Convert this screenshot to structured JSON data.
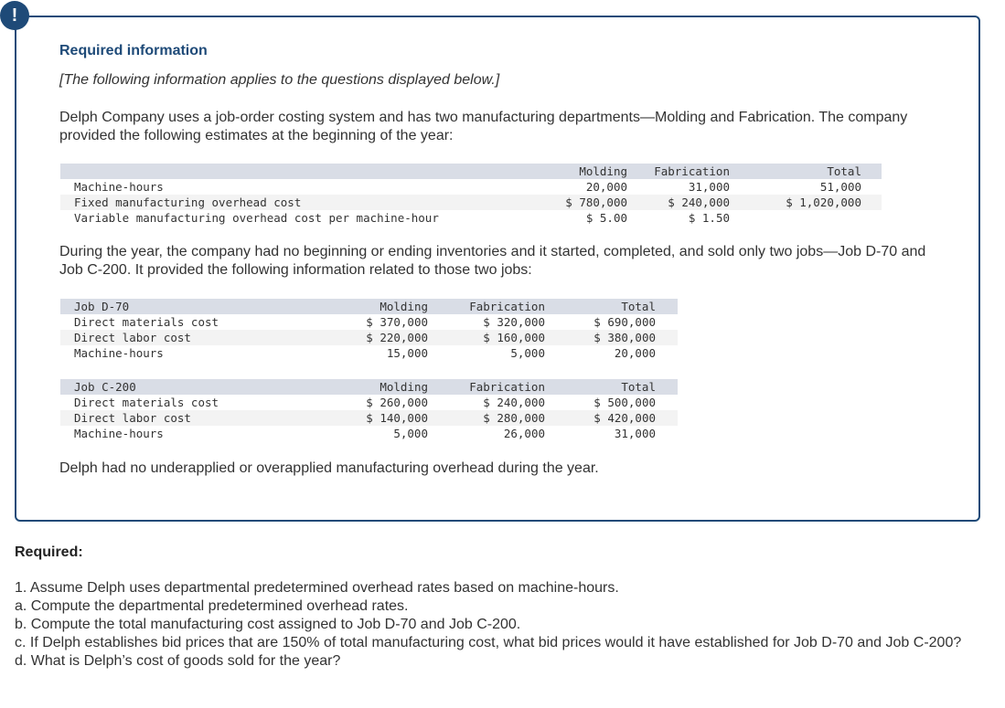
{
  "alert": {
    "icon": "exclamation-icon",
    "symbol": "!"
  },
  "info": {
    "title": "Required information",
    "note": "[The following information applies to the questions displayed below.]",
    "paragraph1": "Delph Company uses a job-order costing system and has two manufacturing departments—Molding and Fabrication. The company provided the following estimates at the beginning of the year:",
    "paragraph2": "During the year, the company had no beginning or ending inventories and it started, completed, and sold only two jobs—Job D-70 and Job C-200. It provided the following information related to those two jobs:",
    "paragraph3": "Delph had no underapplied or overapplied manufacturing overhead during the year."
  },
  "estimates_table": {
    "headers": [
      "",
      "Molding",
      "Fabrication",
      "Total"
    ],
    "rows": [
      [
        "Machine-hours",
        "20,000",
        "31,000",
        "51,000"
      ],
      [
        "Fixed manufacturing overhead cost",
        "$ 780,000",
        "$ 240,000",
        "$ 1,020,000"
      ],
      [
        "Variable manufacturing overhead cost per machine-hour",
        "$ 5.00",
        "$ 1.50",
        ""
      ]
    ]
  },
  "job_d70_table": {
    "headers": [
      "Job D-70",
      "Molding",
      "Fabrication",
      "Total"
    ],
    "rows": [
      [
        "Direct materials cost",
        "$ 370,000",
        "$ 320,000",
        "$ 690,000"
      ],
      [
        "Direct labor cost",
        "$ 220,000",
        "$ 160,000",
        "$ 380,000"
      ],
      [
        "Machine-hours",
        "15,000",
        "5,000",
        "20,000"
      ]
    ]
  },
  "job_c200_table": {
    "headers": [
      "Job C-200",
      "Molding",
      "Fabrication",
      "Total"
    ],
    "rows": [
      [
        "Direct materials cost",
        "$ 260,000",
        "$ 240,000",
        "$ 500,000"
      ],
      [
        "Direct labor cost",
        "$ 140,000",
        "$ 280,000",
        "$ 420,000"
      ],
      [
        "Machine-hours",
        "5,000",
        "26,000",
        "31,000"
      ]
    ]
  },
  "required": {
    "label": "Required:",
    "items": [
      "1. Assume Delph uses departmental predetermined overhead rates based on machine-hours.",
      "a. Compute the departmental predetermined overhead rates.",
      "b. Compute the total manufacturing cost assigned to Job D-70 and Job C-200.",
      "c. If Delph establishes bid prices that are 150% of total manufacturing cost, what bid prices would it have established for Job D-70 and Job C-200?",
      "d. What is Delph’s cost of goods sold for the year?"
    ]
  },
  "colors": {
    "accent": "#1e4a78",
    "table_header": "#d9dde6",
    "table_alt_row": "#f3f3f3"
  }
}
